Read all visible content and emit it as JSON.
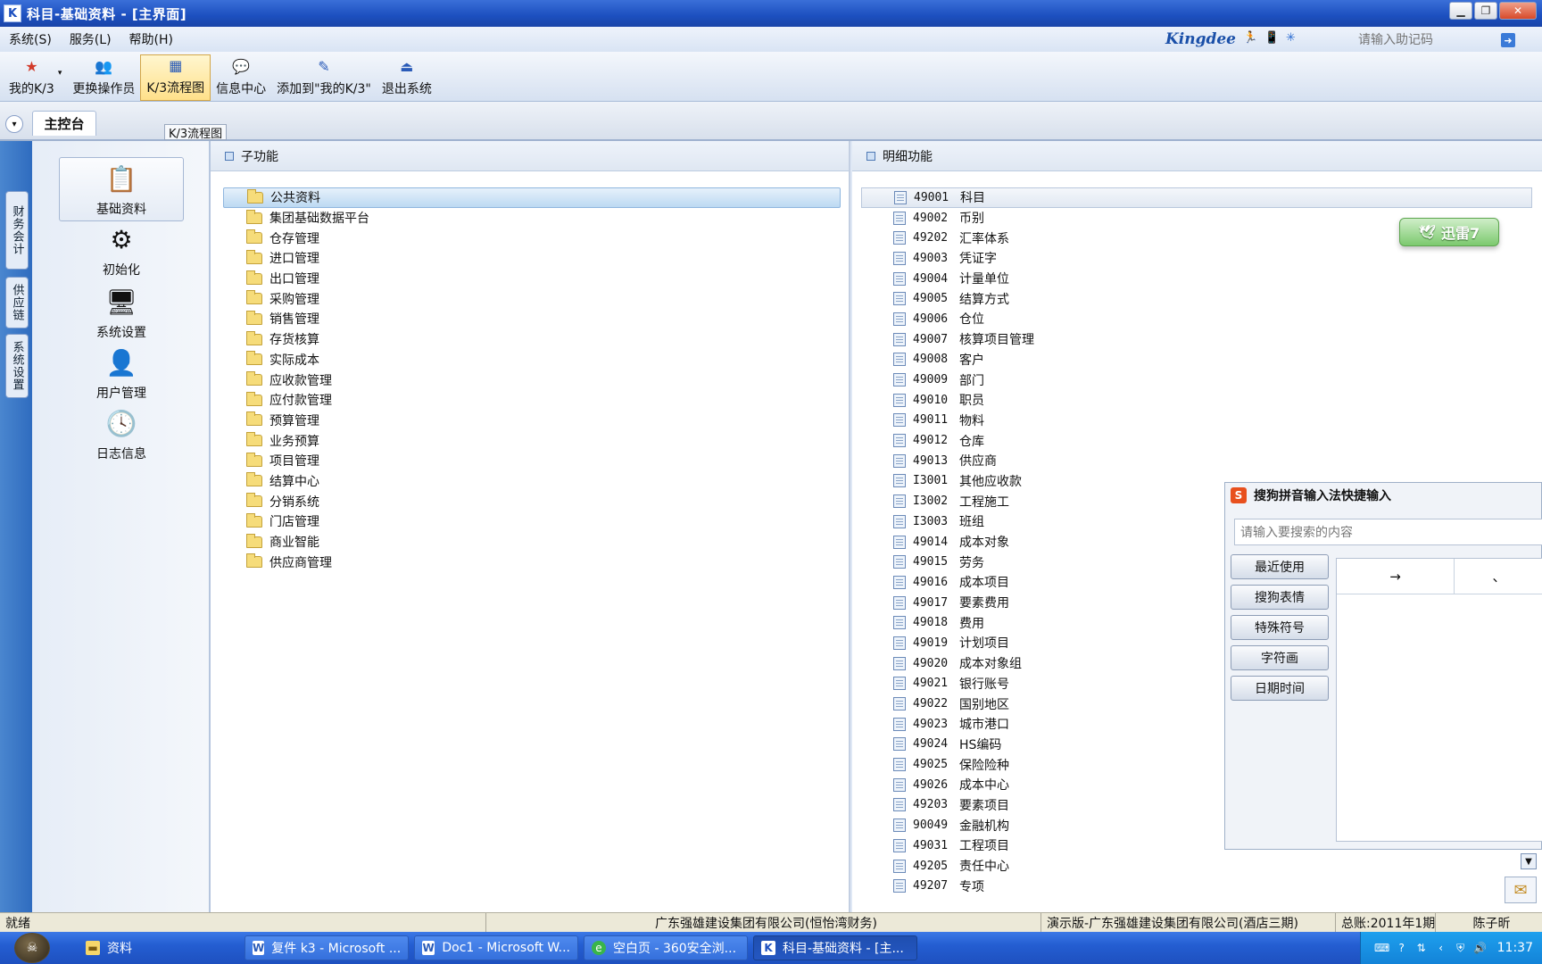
{
  "window": {
    "title": "科目-基础资料 - [主界面]",
    "controls": [
      "▁",
      "❐",
      "✕"
    ]
  },
  "menu": [
    "系统(S)",
    "服务(L)",
    "帮助(H)"
  ],
  "brand": {
    "logo": "Kingdee",
    "mnemonic_placeholder": "请输入助记码"
  },
  "toolbar": [
    {
      "label": "我的K/3",
      "icon": "star-icon",
      "glyph": "★",
      "has_dropdown": true
    },
    {
      "label": "更换操作员",
      "icon": "users-icon",
      "glyph": "👥"
    },
    {
      "label": "K/3流程图",
      "icon": "flowchart-icon",
      "glyph": "▦",
      "active": true
    },
    {
      "label": "信息中心",
      "icon": "message-icon",
      "glyph": "💬"
    },
    {
      "label": "添加到\"我的K/3\"",
      "icon": "add-favorite-icon",
      "glyph": "✎"
    },
    {
      "label": "退出系统",
      "icon": "exit-icon",
      "glyph": "⏏"
    }
  ],
  "tabs": {
    "main": "主控台",
    "floating": "K/3流程图"
  },
  "vertical_tabs": [
    "财务会计",
    "供应链",
    "系统设置"
  ],
  "left_panel": [
    {
      "label": "基础资料",
      "icon": "basic-data-icon",
      "glyph": "📋",
      "selected": true
    },
    {
      "label": "初始化",
      "icon": "initialize-icon",
      "glyph": "⚙"
    },
    {
      "label": "系统设置",
      "icon": "system-settings-icon",
      "glyph": "🖥"
    },
    {
      "label": "用户管理",
      "icon": "user-management-icon",
      "glyph": "👤"
    },
    {
      "label": "日志信息",
      "icon": "log-info-icon",
      "glyph": "🕓"
    }
  ],
  "sub_functions": {
    "header": "子功能",
    "items": [
      "公共资料",
      "集团基础数据平台",
      "仓存管理",
      "进口管理",
      "出口管理",
      "采购管理",
      "销售管理",
      "存货核算",
      "实际成本",
      "应收款管理",
      "应付款管理",
      "预算管理",
      "业务预算",
      "项目管理",
      "结算中心",
      "分销系统",
      "门店管理",
      "商业智能",
      "供应商管理"
    ]
  },
  "detail_functions": {
    "header": "明细功能",
    "items": [
      {
        "code": "49001",
        "name": "科目"
      },
      {
        "code": "49002",
        "name": "币别"
      },
      {
        "code": "49202",
        "name": "汇率体系"
      },
      {
        "code": "49003",
        "name": "凭证字"
      },
      {
        "code": "49004",
        "name": "计量单位"
      },
      {
        "code": "49005",
        "name": "结算方式"
      },
      {
        "code": "49006",
        "name": "仓位"
      },
      {
        "code": "49007",
        "name": "核算项目管理"
      },
      {
        "code": "49008",
        "name": "客户"
      },
      {
        "code": "49009",
        "name": "部门"
      },
      {
        "code": "49010",
        "name": "职员"
      },
      {
        "code": "49011",
        "name": "物料"
      },
      {
        "code": "49012",
        "name": "仓库"
      },
      {
        "code": "49013",
        "name": "供应商"
      },
      {
        "code": "I3001",
        "name": "其他应收款"
      },
      {
        "code": "I3002",
        "name": "工程施工"
      },
      {
        "code": "I3003",
        "name": "班组"
      },
      {
        "code": "49014",
        "name": "成本对象"
      },
      {
        "code": "49015",
        "name": "劳务"
      },
      {
        "code": "49016",
        "name": "成本项目"
      },
      {
        "code": "49017",
        "name": "要素费用"
      },
      {
        "code": "49018",
        "name": "费用"
      },
      {
        "code": "49019",
        "name": "计划项目"
      },
      {
        "code": "49020",
        "name": "成本对象组"
      },
      {
        "code": "49021",
        "name": "银行账号"
      },
      {
        "code": "49022",
        "name": "国别地区"
      },
      {
        "code": "49023",
        "name": "城市港口"
      },
      {
        "code": "49024",
        "name": "HS编码"
      },
      {
        "code": "49025",
        "name": "保险险种"
      },
      {
        "code": "49026",
        "name": "成本中心"
      },
      {
        "code": "49203",
        "name": "要素项目"
      },
      {
        "code": "90049",
        "name": "金融机构"
      },
      {
        "code": "49031",
        "name": "工程项目"
      },
      {
        "code": "49205",
        "name": "责任中心"
      },
      {
        "code": "49207",
        "name": "专项"
      }
    ]
  },
  "xunlei": {
    "label": "迅雷7"
  },
  "sogou": {
    "title": "搜狗拼音输入法快捷输入",
    "search_placeholder": "请输入要搜索的内容",
    "buttons": [
      "最近使用",
      "搜狗表情",
      "特殊符号",
      "字符画",
      "日期时间"
    ],
    "cells": [
      "→",
      "、"
    ]
  },
  "statusbar": {
    "status": "就绪",
    "company": "广东强雄建设集团有限公司(恒怡湾财务)",
    "account": "演示版-广东强雄建设集团有限公司(酒店三期)",
    "period": "总账:2011年1期",
    "user": "陈子昕"
  },
  "taskbar": {
    "items": [
      {
        "label": "资料",
        "icon": "folder-icon",
        "style": "flat"
      },
      {
        "label": "复件 k3 - Microsoft ...",
        "icon": "word-icon",
        "style": "btn"
      },
      {
        "label": "Doc1 - Microsoft W...",
        "icon": "word-icon",
        "style": "btn"
      },
      {
        "label": "空白页 - 360安全浏...",
        "icon": "browser-360-icon",
        "style": "btn"
      },
      {
        "label": "科目-基础资料 - [主...",
        "icon": "k3-icon",
        "style": "active"
      }
    ],
    "clock": "11:37"
  },
  "colors": {
    "title_bar": "#1c4fbf",
    "selection": "#bcd9f2",
    "taskbar": "#245ed2",
    "tray": "#1383d8"
  }
}
